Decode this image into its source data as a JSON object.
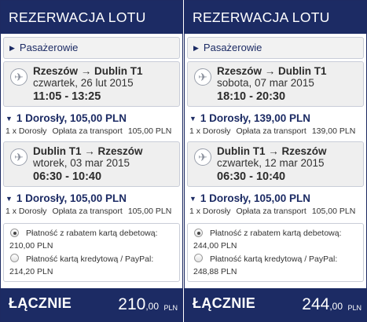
{
  "panels": [
    {
      "title": "REZERWACJA LOTU",
      "passengers_label": "Pasażerowie",
      "flights": [
        {
          "route": "Rzeszów → Dublin T1",
          "date": "czwartek, 26 lut 2015",
          "time": "11:05 - 13:25",
          "price": "1 Dorosły, 105,00 PLN",
          "fee_passenger": "1 x Dorosły",
          "fee_label": "Opłata za transport",
          "fee_amount": "105,00 PLN"
        },
        {
          "route": "Dublin T1 → Rzeszów",
          "date": "wtorek, 03 mar 2015",
          "time": "06:30 - 10:40",
          "price": "1 Dorosły, 105,00 PLN",
          "fee_passenger": "1 x Dorosły",
          "fee_label": "Opłata za transport",
          "fee_amount": "105,00 PLN"
        }
      ],
      "payment": {
        "debit_label": "Płatność z rabatem kartą debetową:",
        "debit_amount": "210,00 PLN",
        "credit_label": "Płatność kartą kredytową / PayPal:",
        "credit_amount": "214,20 PLN",
        "selected": "debit"
      },
      "total": {
        "label": "ŁĄCZNIE",
        "amount": "210",
        "cents": ",00",
        "currency": "PLN"
      }
    },
    {
      "title": "REZERWACJA LOTU",
      "passengers_label": "Pasażerowie",
      "flights": [
        {
          "route": "Rzeszów → Dublin T1",
          "date": "sobota, 07 mar 2015",
          "time": "18:10 - 20:30",
          "price": "1 Dorosły, 139,00 PLN",
          "fee_passenger": "1 x Dorosły",
          "fee_label": "Opłata za transport",
          "fee_amount": "139,00 PLN"
        },
        {
          "route": "Dublin T1 → Rzeszów",
          "date": "czwartek, 12 mar 2015",
          "time": "06:30 - 10:40",
          "price": "1 Dorosły, 105,00 PLN",
          "fee_passenger": "1 x Dorosły",
          "fee_label": "Opłata za transport",
          "fee_amount": "105,00 PLN"
        }
      ],
      "payment": {
        "debit_label": "Płatność z rabatem kartą debetową:",
        "debit_amount": "244,00 PLN",
        "credit_label": "Płatność kartą kredytową / PayPal:",
        "credit_amount": "248,88 PLN",
        "selected": "debit"
      },
      "total": {
        "label": "ŁĄCZNIE",
        "amount": "244",
        "cents": ",00",
        "currency": "PLN"
      }
    }
  ],
  "icons": {
    "plane": "plane-icon",
    "expand": "triangle-right-icon",
    "collapse": "triangle-down-icon"
  },
  "colors": {
    "header_bg": "#1c2b64",
    "panel_border": "#1d2a62",
    "box_bg": "#efefef"
  }
}
